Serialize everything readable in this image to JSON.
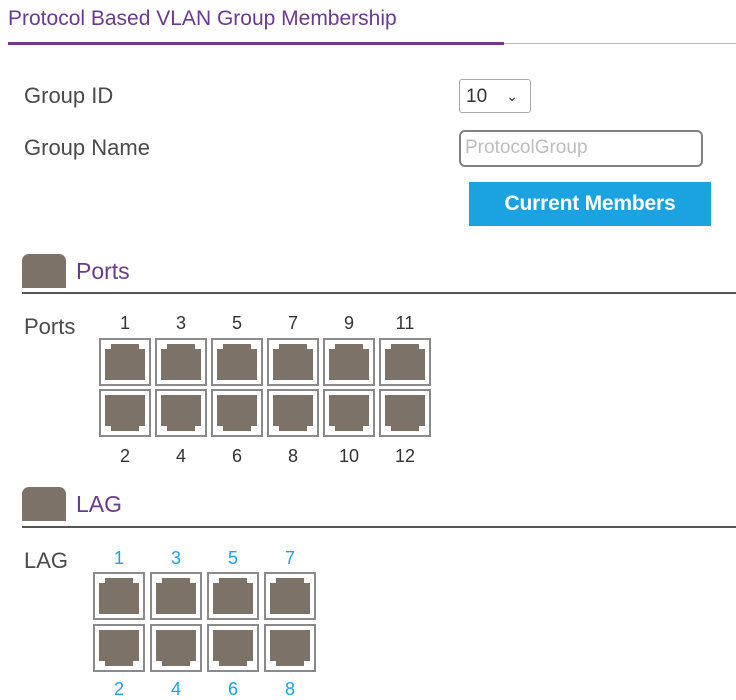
{
  "header": {
    "title": "Protocol Based VLAN Group Membership"
  },
  "form": {
    "group_id_label": "Group ID",
    "group_id_value": "10",
    "group_name_label": "Group Name",
    "group_name_placeholder": "ProtocolGroup",
    "current_members_label": "Current Members"
  },
  "ports_section": {
    "title": "Ports",
    "row_label": "Ports",
    "top_numbers": [
      "1",
      "3",
      "5",
      "7",
      "9",
      "11"
    ],
    "bottom_numbers": [
      "2",
      "4",
      "6",
      "8",
      "10",
      "12"
    ]
  },
  "lag_section": {
    "title": "LAG",
    "row_label": "LAG",
    "top_numbers": [
      "1",
      "3",
      "5",
      "7"
    ],
    "bottom_numbers": [
      "2",
      "4",
      "6",
      "8"
    ]
  },
  "colors": {
    "accent": "#6b3a8e",
    "button": "#1aa3e0",
    "port": "#7d7268"
  }
}
